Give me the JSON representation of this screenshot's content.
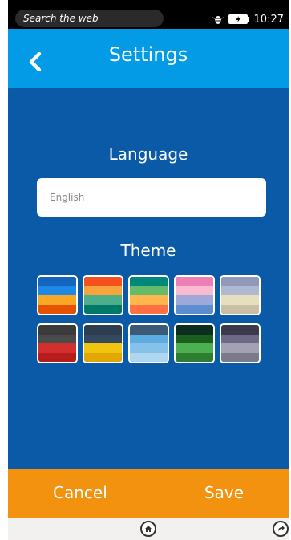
{
  "status_bar": {
    "search_placeholder": "Search the web",
    "time": "10:27",
    "icons": [
      "bug-icon",
      "battery-icon"
    ]
  },
  "header": {
    "title": "Settings",
    "back_icon": "chevron-left-icon"
  },
  "language": {
    "label": "Language",
    "value": "English"
  },
  "theme": {
    "label": "Theme",
    "swatches": [
      [
        "#1565c0",
        "#1e88e5",
        "#f9a825",
        "#e65100"
      ],
      [
        "#f4511e",
        "#f6a53c",
        "#4caf8a",
        "#00796b"
      ],
      [
        "#00897b",
        "#66bb6a",
        "#ffb74d",
        "#ff7043"
      ],
      [
        "#ec7fb5",
        "#f8bbd0",
        "#9fa8da",
        "#5c8ecf"
      ],
      [
        "#9099b8",
        "#b0b8d0",
        "#e6dfbf",
        "#c9bfa5"
      ],
      [
        "#3b3b3b",
        "#4a4a4a",
        "#d32f2f",
        "#b71c1c"
      ],
      [
        "#2c3e50",
        "#34495e",
        "#f1c40f",
        "#e0a800"
      ],
      [
        "#3c5a75",
        "#5dade2",
        "#85c1e9",
        "#aed6f1"
      ],
      [
        "#0b2e1d",
        "#1b5e20",
        "#4caf50",
        "#2e7d32"
      ],
      [
        "#3a3a4a",
        "#6c6a85",
        "#a3a1b3",
        "#7a7a8a"
      ]
    ]
  },
  "footer": {
    "cancel_label": "Cancel",
    "save_label": "Save"
  },
  "colors": {
    "background": "#0a5aa8",
    "header": "#039be5",
    "footer": "#f3920e"
  }
}
